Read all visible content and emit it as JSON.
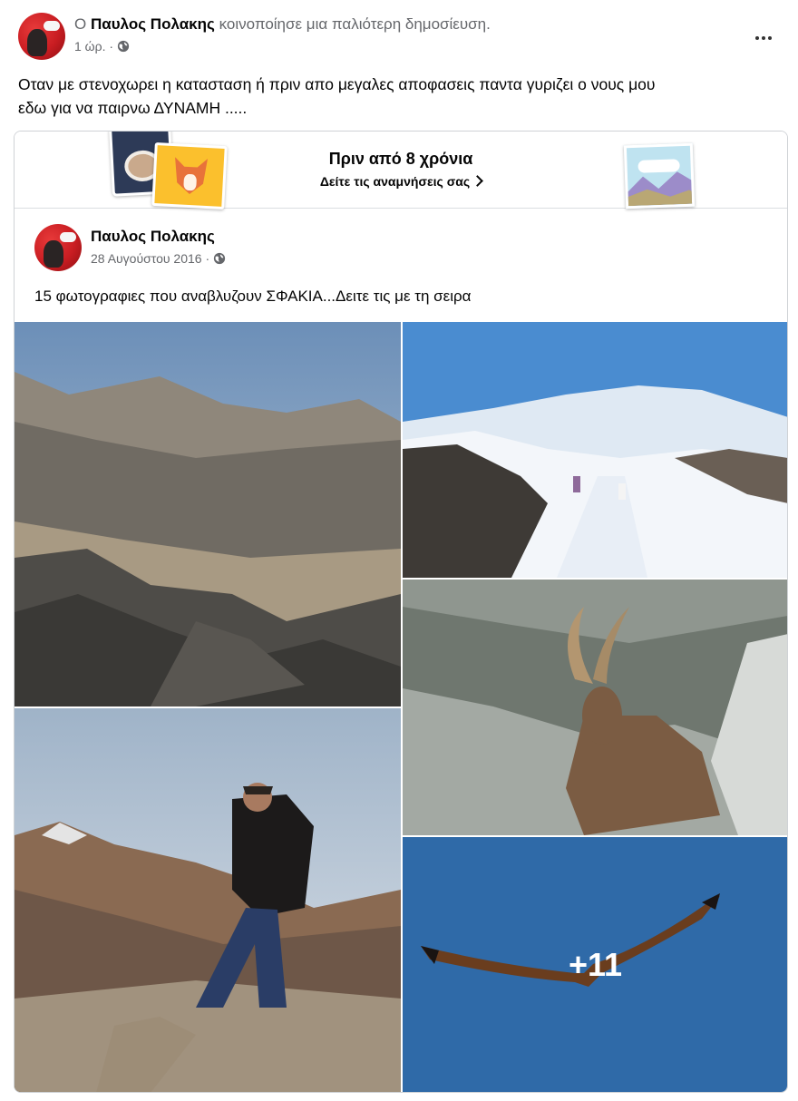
{
  "share_header": {
    "prefix": "Ο",
    "author": "Παυλος Πολακης",
    "action": "κοινοποίησε μια παλιότερη δημοσίευση.",
    "time": "1 ώρ. ·",
    "privacy_icon": "globe-icon",
    "more_icon": "more-options-icon"
  },
  "post_text": {
    "line1": "Οταν με στενοχωρει η κατασταση ή πριν απο μεγαλες αποφασεις παντα γυριζει ο νους μου",
    "line2": "εδω  για να παιρνω ΔΥΝΑΜΗ ....."
  },
  "memory": {
    "title": "Πριν από 8 χρόνια",
    "subtitle": "Δείτε τις αναμνήσεις σας"
  },
  "shared_post": {
    "author": "Παυλος Πολακης",
    "date": "28 Αυγούστου 2016 ·",
    "text": "15 φωτογραφιες που αναβλυζουν ΣΦΑΚΙΑ...Δειτε τις με τη σειρα",
    "more_photos": "+11"
  },
  "colors": {
    "secondary_text": "#65676b",
    "primary_text": "#050505",
    "card_border": "#cfd2d6"
  }
}
